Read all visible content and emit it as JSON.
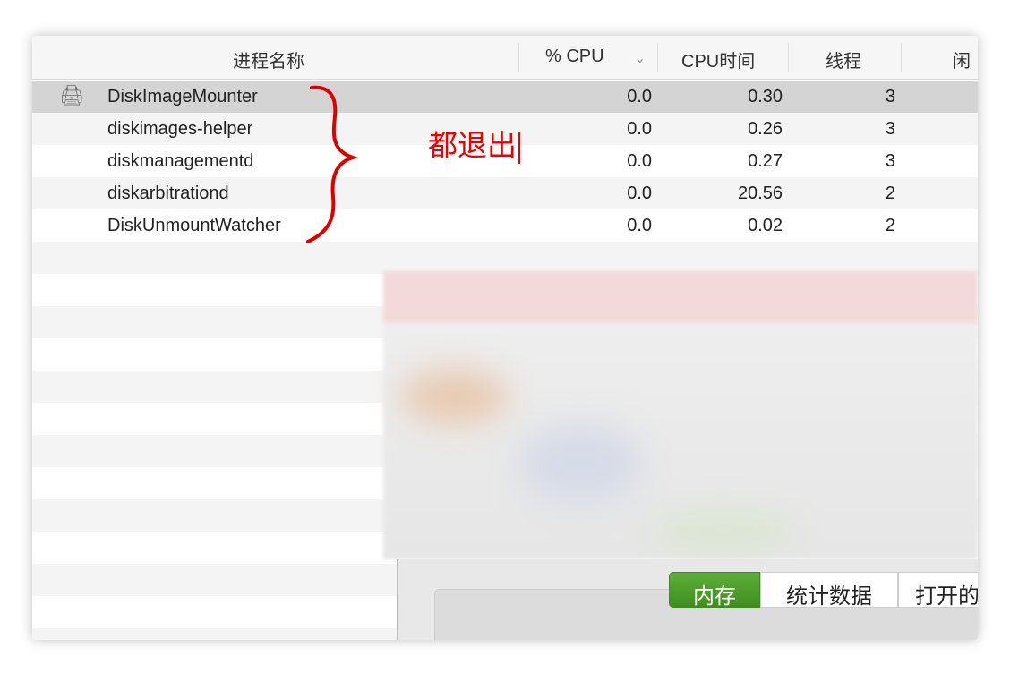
{
  "columns": [
    "进程名称",
    "% CPU",
    "CPU时间",
    "线程",
    "闲"
  ],
  "sort_icon": "chevron-down-icon",
  "rows": [
    {
      "name": "DiskImageMounter",
      "cpu": "0.0",
      "time": "0.30",
      "threads": "3",
      "icon": "disk-image-mounter-icon",
      "selected": true
    },
    {
      "name": "diskimages-helper",
      "cpu": "0.0",
      "time": "0.26",
      "threads": "3"
    },
    {
      "name": "diskmanagementd",
      "cpu": "0.0",
      "time": "0.27",
      "threads": "3"
    },
    {
      "name": "diskarbitrationd",
      "cpu": "0.0",
      "time": "20.56",
      "threads": "2"
    },
    {
      "name": "DiskUnmountWatcher",
      "cpu": "0.0",
      "time": "0.02",
      "threads": "2"
    }
  ],
  "annotation": {
    "text": "都退出",
    "color": "#e00000"
  },
  "tabs": [
    "内存",
    "统计数据",
    "打开的"
  ],
  "accent": "#4a9a2a"
}
